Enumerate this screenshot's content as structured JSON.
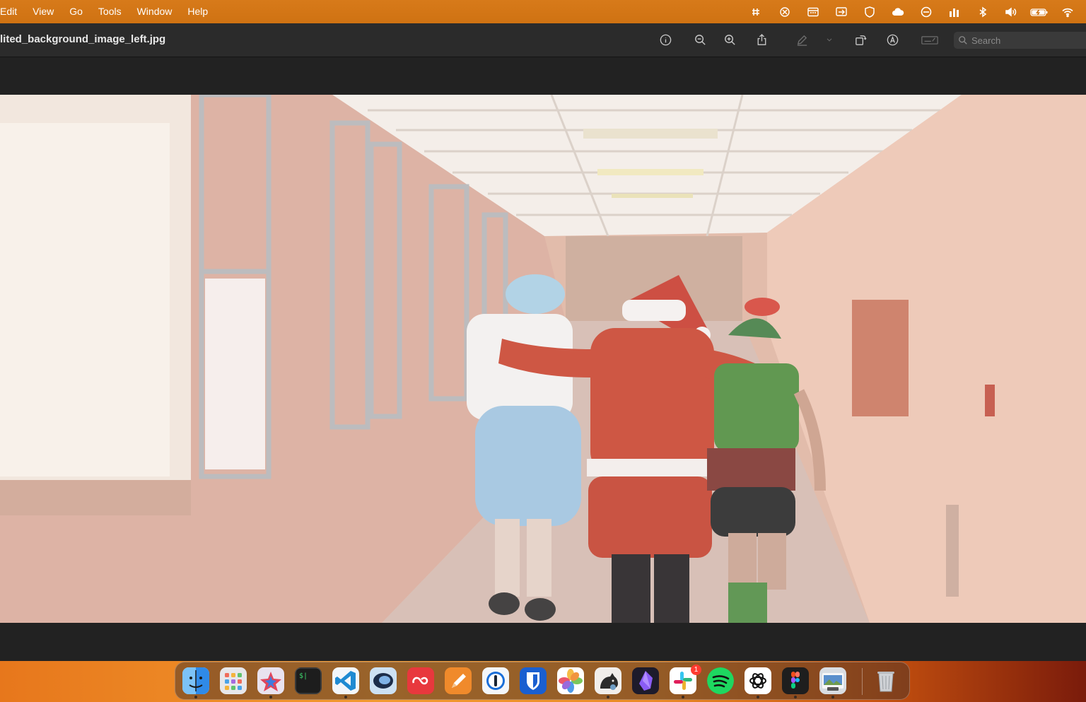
{
  "menubar": {
    "menus": [
      "Edit",
      "View",
      "Go",
      "Tools",
      "Window",
      "Help"
    ],
    "status_icons": [
      "grid-menu-icon",
      "chatgpt-icon",
      "calendar-icon",
      "screen-mirror-icon",
      "shield-icon",
      "cloud-icon",
      "focus-icon",
      "stats-icon",
      "bluetooth-icon",
      "volume-icon",
      "battery-charging-icon",
      "wifi-icon"
    ]
  },
  "toolbar": {
    "title": "lited_background_image_left.jpg",
    "search_placeholder": "Search",
    "icons": [
      "info-icon",
      "zoom-out-icon",
      "zoom-in-icon",
      "share-icon",
      "markup-pencil-icon",
      "chevron-down-icon",
      "rotate-icon",
      "annotate-icon",
      "form-fill-icon",
      "search-icon"
    ]
  },
  "photo": {
    "description_icon": "hallway-photo-icon"
  },
  "dock": {
    "apps": [
      "finder",
      "launchpad",
      "app-store",
      "terminal",
      "vscode",
      "proxyman",
      "creative-cloud",
      "pages-pen",
      "1password",
      "bitwarden",
      "photos",
      "vlc-cat",
      "obsidian",
      "slack",
      "spotify",
      "chatgpt",
      "figma",
      "preview",
      "trash"
    ],
    "slack_badge": "1"
  },
  "colors": {
    "menubar": "#d77a1a",
    "toolbar": "#2b2b2b",
    "canvas": "#222222"
  }
}
